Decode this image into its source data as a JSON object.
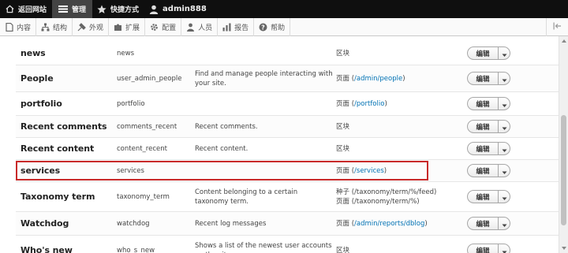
{
  "toolbar": {
    "back_label": "返回网站",
    "manage_label": "管理",
    "shortcuts_label": "快捷方式",
    "user_label": "admin888"
  },
  "tray": {
    "items": [
      {
        "label": "内容",
        "icon": "content-icon"
      },
      {
        "label": "结构",
        "icon": "structure-icon"
      },
      {
        "label": "外观",
        "icon": "appearance-icon"
      },
      {
        "label": "扩展",
        "icon": "extend-icon"
      },
      {
        "label": "配置",
        "icon": "config-icon"
      },
      {
        "label": "人员",
        "icon": "people-icon"
      },
      {
        "label": "报告",
        "icon": "reports-icon"
      },
      {
        "label": "帮助",
        "icon": "help-icon"
      }
    ]
  },
  "operation_label": "编辑",
  "rows": [
    {
      "name": "news",
      "machine": "news",
      "desc": "",
      "type_text": "区块",
      "type_link": ""
    },
    {
      "name": "People",
      "machine": "user_admin_people",
      "desc": "Find and manage people interacting with your site.",
      "type_text": "页面 (",
      "type_link": "/admin/people",
      "type_suffix": ")"
    },
    {
      "name": "portfolio",
      "machine": "portfolio",
      "desc": "",
      "type_text": "页面 (",
      "type_link": "/portfolio",
      "type_suffix": ")"
    },
    {
      "name": "Recent comments",
      "machine": "comments_recent",
      "desc": "Recent comments.",
      "type_text": "区块",
      "type_link": ""
    },
    {
      "name": "Recent content",
      "machine": "content_recent",
      "desc": "Recent content.",
      "type_text": "区块",
      "type_link": ""
    },
    {
      "name": "services",
      "machine": "services",
      "desc": "",
      "type_text": "页面 (",
      "type_link": "/services",
      "type_suffix": ")"
    },
    {
      "name": "Taxonomy term",
      "machine": "taxonomy_term",
      "desc": "Content belonging to a certain taxonomy term.",
      "type_text": "种子 (/taxonomy/term/%/feed)",
      "type_line2": "页面 (/taxonomy/term/%)",
      "type_link": ""
    },
    {
      "name": "Watchdog",
      "machine": "watchdog",
      "desc": "Recent log messages",
      "type_text": "页面 (",
      "type_link": "/admin/reports/dblog",
      "type_suffix": ")"
    },
    {
      "name": "Who's new",
      "machine": "who_s_new",
      "desc": "Shows a list of the newest user accounts on the site.",
      "type_text": "区块",
      "type_link": ""
    }
  ],
  "colors": {
    "highlight": "#c82a2a",
    "link": "#0071b3",
    "toolbar_bg": "#0f0f0f"
  }
}
